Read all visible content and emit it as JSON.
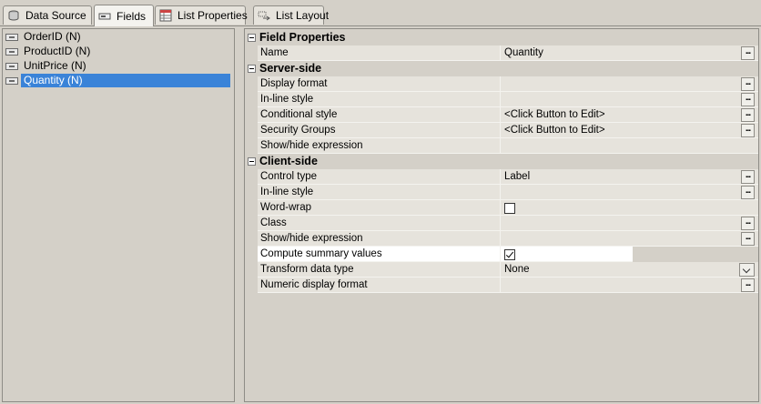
{
  "tabs": [
    {
      "label": "Data Source",
      "icon": "database-icon",
      "active": false
    },
    {
      "label": "Fields",
      "icon": "field-icon",
      "active": true
    },
    {
      "label": "List Properties",
      "icon": "grid-properties-icon",
      "active": false
    },
    {
      "label": "List Layout",
      "icon": "layout-icon",
      "active": false
    }
  ],
  "fields": [
    {
      "label": "OrderID (N)"
    },
    {
      "label": "ProductID (N)"
    },
    {
      "label": "UnitPrice (N)"
    },
    {
      "label": "Quantity (N)",
      "selected": true
    }
  ],
  "properties": {
    "field_properties": {
      "label": "Field Properties",
      "name": {
        "label": "Name",
        "value": "Quantity",
        "button": "..."
      }
    },
    "server_side": {
      "label": "Server-side",
      "display_format": {
        "label": "Display format",
        "value": "",
        "button": "..."
      },
      "inline_style": {
        "label": "In-line style",
        "value": "",
        "button": "..."
      },
      "conditional_style": {
        "label": "Conditional style",
        "value": "<Click Button to Edit>",
        "button": "..."
      },
      "security_groups": {
        "label": "Security Groups",
        "value": "<Click Button to Edit>",
        "button": "..."
      },
      "show_hide": {
        "label": "Show/hide expression",
        "value": ""
      }
    },
    "client_side": {
      "label": "Client-side",
      "control_type": {
        "label": "Control type",
        "value": "Label",
        "button": "..."
      },
      "inline_style": {
        "label": "In-line style",
        "value": "",
        "button": "..."
      },
      "word_wrap": {
        "label": "Word-wrap",
        "checked": false
      },
      "class": {
        "label": "Class",
        "value": "",
        "button": "..."
      },
      "show_hide": {
        "label": "Show/hide expression",
        "value": "",
        "button": "..."
      },
      "compute_summary": {
        "label": "Compute summary values",
        "checked": true
      },
      "transform_data_type": {
        "label": "Transform data type",
        "value": "None"
      },
      "numeric_display_format": {
        "label": "Numeric display format",
        "value": "",
        "button": "..."
      }
    }
  },
  "colors": {
    "selection": "#3a83d8",
    "panel": "#d4d0c8",
    "row": "#e6e3dc"
  }
}
